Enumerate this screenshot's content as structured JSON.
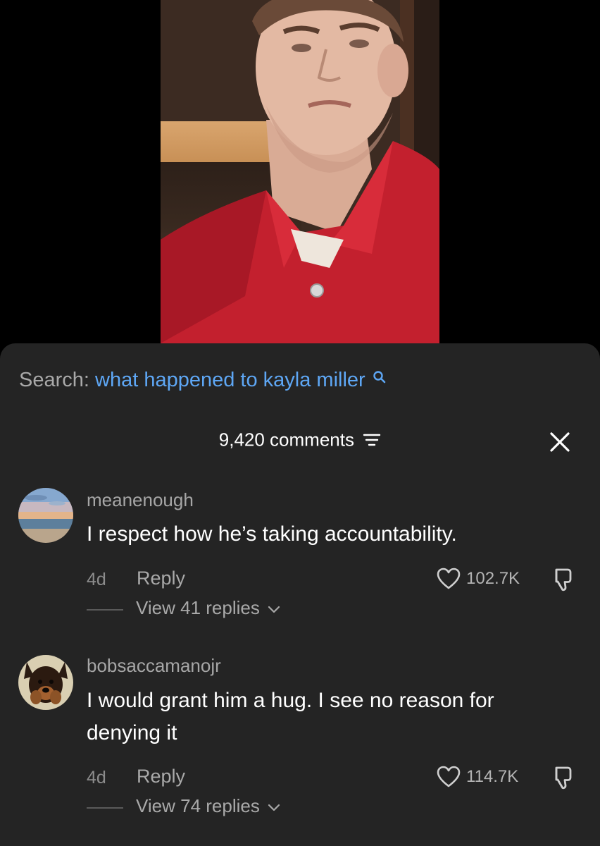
{
  "search": {
    "label": "Search:",
    "query": "what happened to kayla miller",
    "query_color": "#5ea7f5"
  },
  "header": {
    "comment_count": "9,420 comments",
    "sort_icon": "sort-lines-icon",
    "close_icon": "close-icon"
  },
  "comments": [
    {
      "username": "meanenough",
      "text": "I respect how he’s taking accountability.",
      "time": "4d",
      "reply_label": "Reply",
      "likes": "102.7K",
      "view_replies": "View 41 replies",
      "avatar": "ocean-sunset-avatar"
    },
    {
      "username": "bobsaccamanojr",
      "text": "I would grant him a hug. I see no reason for denying it",
      "time": "4d",
      "reply_label": "Reply",
      "likes": "114.7K",
      "view_replies": "View 74 replies",
      "avatar": "dog-avatar"
    }
  ],
  "colors": {
    "sheet_bg": "#242424",
    "page_bg": "#000000",
    "link_blue": "#5ea7f5"
  }
}
